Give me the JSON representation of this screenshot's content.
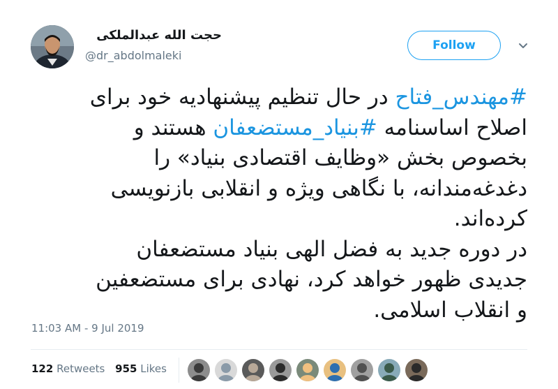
{
  "tweet": {
    "display_name": "حجت الله عبدالملکی",
    "username": "@dr_abdolmaleki",
    "follow_label": "Follow",
    "text_lines": [
      [
        {
          "t": "#مهندس_فتاح",
          "h": true
        },
        {
          "t": " در حال تنظیم پیشنهادیه خود برای",
          "h": false
        }
      ],
      [
        {
          "t": "اصلاح اساسنامه ",
          "h": false
        },
        {
          "t": "#بنیاد_مستضعفان",
          "h": true
        },
        {
          "t": " هستند و",
          "h": false
        }
      ],
      [
        {
          "t": "بخصوص بخش «وظایف اقتصادی بنیاد» را",
          "h": false
        }
      ],
      [
        {
          "t": "دغدغه‌مندانه، با نگاهی ویژه و انقلابی بازنویسی",
          "h": false
        }
      ],
      [
        {
          "t": "کرده‌اند.",
          "h": false
        }
      ],
      [
        {
          "t": "در دوره جدید به فضل الهی بنیاد مستضعفان",
          "h": false
        }
      ],
      [
        {
          "t": "جدیدی ظهور خواهد کرد، نهادی برای مستضعفین",
          "h": false
        }
      ],
      [
        {
          "t": "و انقلاب اسلامی.",
          "h": false
        }
      ]
    ],
    "timestamp": "11:03 AM - 9 Jul 2019",
    "retweets_count": "122",
    "retweets_label": "Retweets",
    "likes_count": "955",
    "likes_label": "Likes"
  },
  "colors": {
    "link": "#1b95e0",
    "follow_accent": "#1da1f2",
    "secondary_text": "#657786"
  },
  "icons": {
    "caret": "chevron-down-icon"
  },
  "liker_avatars": [
    {
      "bg": "#8c8c8c",
      "fg": "#3a3a3a"
    },
    {
      "bg": "#d9d9d9",
      "fg": "#8a9aa8"
    },
    {
      "bg": "#5a5a5a",
      "fg": "#b8a898"
    },
    {
      "bg": "#9a9a9a",
      "fg": "#2c2c2c"
    },
    {
      "bg": "#7a8a7a",
      "fg": "#f0c080"
    },
    {
      "bg": "#e8c080",
      "fg": "#2d6fb0"
    },
    {
      "bg": "#a0a0a0",
      "fg": "#505050"
    },
    {
      "bg": "#88aab8",
      "fg": "#3a5a4a"
    },
    {
      "bg": "#7a6a5a",
      "fg": "#2a2a2a"
    }
  ]
}
